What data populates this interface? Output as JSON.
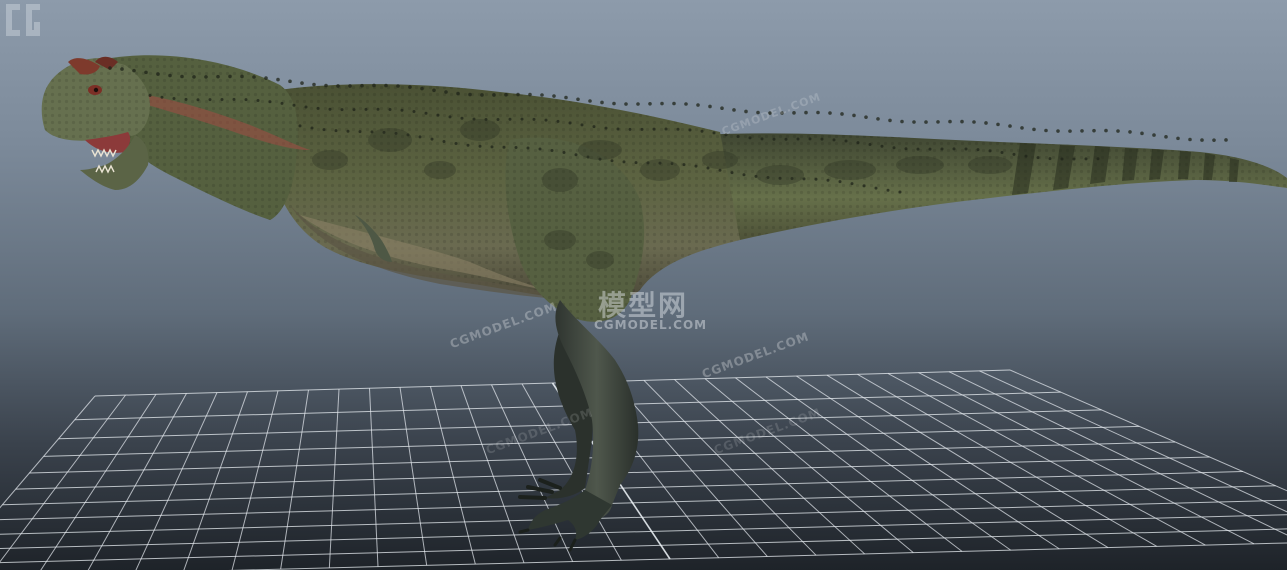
{
  "viewport": {
    "scene": "3d-model-viewport",
    "subject": "carnotaurus-dinosaur-model"
  },
  "watermark": {
    "center_cn": "模型网",
    "center_en": "CGMODEL.COM",
    "diagonal": [
      "CGMODEL.COM",
      "CGMODEL.COM",
      "CGMODEL.COM",
      "CGMODEL.COM",
      "CGMODEL.COM"
    ]
  },
  "colors": {
    "background_top": "#8d9bab",
    "background_bottom": "#1e2329",
    "grid_line": "#e8edf2",
    "skin_base": "#58603f",
    "skin_belly": "#7a755a",
    "skin_spots": "#2c3222"
  }
}
